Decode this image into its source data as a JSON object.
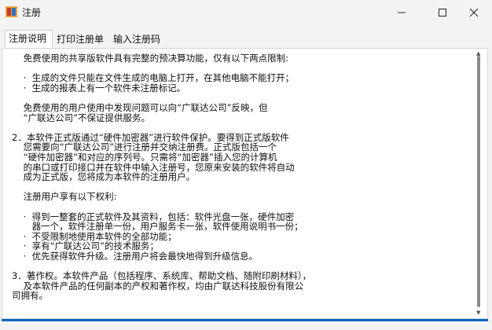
{
  "window": {
    "title": "注册"
  },
  "tabs": [
    "注册说明",
    "打印注册单",
    "输入注册码"
  ],
  "lines": [
    "    免费使用的共享版软件具有完整的预决算功能，仅有以下两点限制:",
    "",
    "    ·  生成的文件只能在文件生成的电脑上打开，在其他电脑不能打开；",
    "    ·  生成的报表上有一个软件未注册标记。",
    "",
    "    免费使用的用户使用中发现问题可以向“广联达公司”反映，但",
    "    “广联达公司”不保证提供服务。",
    "",
    "2．本软件正式版通过“硬件加密器”进行软件保护。要得到正式版软件",
    "    您需要向“广联达公司”进行注册并交纳注册费。正式版包括一个",
    "    “硬件加密器”和对应的序列号。只需将“加密器”插入您的计算机",
    "    的串口或打印接口并在软件中输入注册号，您原来安装的软件将自动",
    "    成为正式版，您将成为本软件的注册用户。",
    "",
    "    注册用户享有以下权利:",
    "",
    "    ·  得到一整套的正式软件及其资料，包括：软件光盘一张，硬件加密",
    "       器一个，软件注册单一份，用户服务卡一张，软件使用说明书一份；",
    "    ·  不受限制地使用本软件的全部功能；",
    "    ·  享有“广联达公司”的技术服务；",
    "    ·  优先获得软件升级。注册用户将会最快地得到升级信息。",
    "",
    "3．著作权。本软件产品（包括程序、系统库、帮助文档、随附印刷材料），",
    "    及本软件产品的任何副本的产权和著作权，均由广联达科技股份有限公",
    "司拥有。",
    "",
    "_"
  ]
}
